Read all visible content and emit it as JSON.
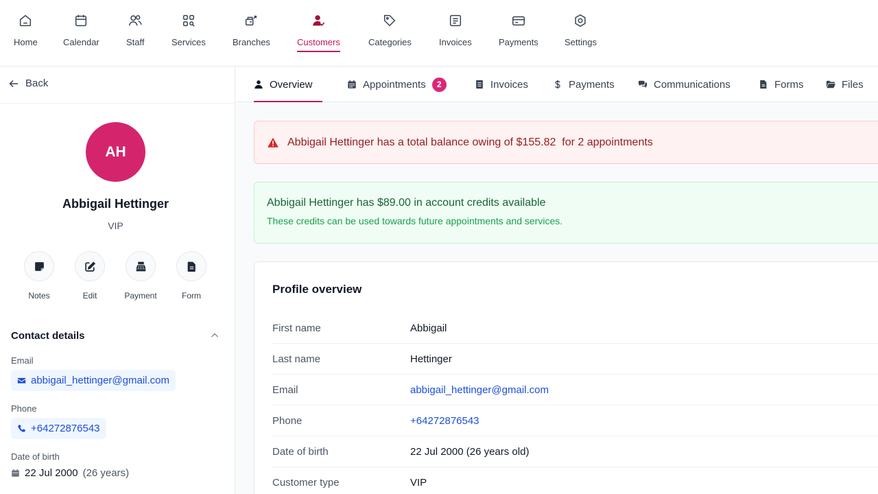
{
  "nav": {
    "items": [
      {
        "label": "Home",
        "icon": "home-icon"
      },
      {
        "label": "Calendar",
        "icon": "calendar-icon"
      },
      {
        "label": "Staff",
        "icon": "staff-icon"
      },
      {
        "label": "Services",
        "icon": "services-icon"
      },
      {
        "label": "Branches",
        "icon": "branches-icon"
      },
      {
        "label": "Customers",
        "icon": "customers-icon",
        "active": true
      },
      {
        "label": "Categories",
        "icon": "tag-icon"
      },
      {
        "label": "Invoices",
        "icon": "invoice-icon"
      },
      {
        "label": "Payments",
        "icon": "card-icon"
      },
      {
        "label": "Settings",
        "icon": "gear-icon"
      }
    ],
    "accent": "#be185d"
  },
  "sidebar": {
    "back_label": "Back",
    "avatar_initials": "AH",
    "avatar_color": "#d4256c",
    "name": "Abbigail Hettinger",
    "type": "VIP",
    "actions": [
      {
        "label": "Notes",
        "icon": "note-icon"
      },
      {
        "label": "Edit",
        "icon": "edit-icon"
      },
      {
        "label": "Payment",
        "icon": "register-icon"
      },
      {
        "label": "Form",
        "icon": "file-icon"
      }
    ],
    "contact": {
      "title": "Contact details",
      "email_label": "Email",
      "email": "abbigail_hettinger@gmail.com",
      "phone_label": "Phone",
      "phone": "+64272876543",
      "dob_label": "Date of birth",
      "dob": "22 Jul 2000",
      "dob_age": "(26 years)"
    }
  },
  "tabs": [
    {
      "label": "Overview",
      "icon": "user-icon",
      "active": true
    },
    {
      "label": "Appointments",
      "icon": "calendar-icon",
      "badge": "2"
    },
    {
      "label": "Invoices",
      "icon": "invoice-icon"
    },
    {
      "label": "Payments",
      "icon": "dollar-icon"
    },
    {
      "label": "Communications",
      "icon": "chat-icon"
    },
    {
      "label": "Forms",
      "icon": "form-icon"
    },
    {
      "label": "Files",
      "icon": "folder-icon"
    }
  ],
  "alerts": {
    "balance": "Abbigail Hettinger has a total balance owing of $155.82  for 2 appointments",
    "credits_title": "Abbigail Hettinger has $89.00 in account credits available",
    "credits_sub": "These credits can be used towards future appointments and services."
  },
  "profile": {
    "title": "Profile overview",
    "rows": [
      {
        "label": "First name",
        "value": "Abbigail"
      },
      {
        "label": "Last name",
        "value": "Hettinger"
      },
      {
        "label": "Email",
        "value": "abbigail_hettinger@gmail.com",
        "link": true
      },
      {
        "label": "Phone",
        "value": "+64272876543",
        "link": true
      },
      {
        "label": "Date of birth",
        "value": "22 Jul 2000 (26 years old)"
      },
      {
        "label": "Customer type",
        "value": "VIP"
      }
    ]
  }
}
